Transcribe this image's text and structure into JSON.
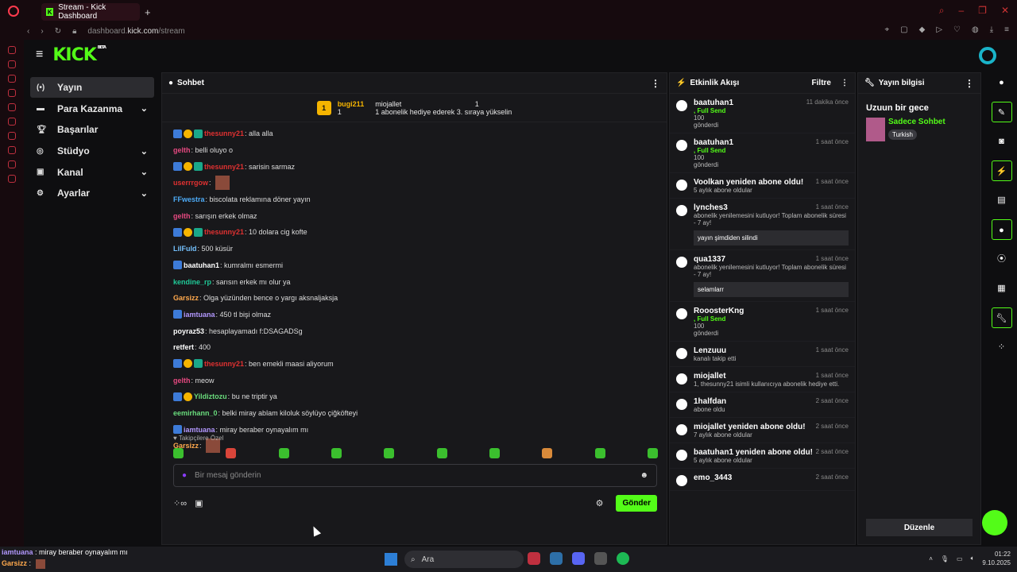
{
  "browser": {
    "tab_title": "Stream - Kick Dashboard",
    "url_prefix": "dashboard.",
    "url_host": "kick.com",
    "url_path": "/stream"
  },
  "app": {
    "logo": "KICK",
    "beta": "BETA",
    "nav": [
      {
        "label": "Yayın",
        "icon": "broadcast-icon",
        "active": true
      },
      {
        "label": "Para Kazanma",
        "icon": "money-icon"
      },
      {
        "label": "Başarılar",
        "icon": "trophy-icon"
      },
      {
        "label": "Stüdyo",
        "icon": "studio-icon"
      },
      {
        "label": "Kanal",
        "icon": "channel-icon"
      },
      {
        "label": "Ayarlar",
        "icon": "settings-icon"
      }
    ]
  },
  "chat": {
    "title": "Sohbet",
    "pinned": {
      "gifter": "bugi211",
      "gifter_count": "1",
      "recipient": "miojallet",
      "recipient_count": "1",
      "message": "1 abonelik hediye ederek 3. sıraya yükselin",
      "rank": "1"
    },
    "messages": [
      {
        "user": "thesunny21",
        "text": "alla alla",
        "color": "#e03131",
        "badges": 3
      },
      {
        "user": "gelth",
        "text": "belli oluyo o",
        "color": "#e64980",
        "badges": 0
      },
      {
        "user": "thesunny21",
        "text": "sarisin sarmaz",
        "color": "#e03131",
        "badges": 3
      },
      {
        "user": "userrrgow",
        "text": "",
        "color": "#e03131",
        "badges": 0,
        "emote": true
      },
      {
        "user": "FFwestra",
        "text": "biscolata reklamına döner yayın",
        "color": "#4dabf7",
        "badges": 0
      },
      {
        "user": "gelth",
        "text": "sarışın erkek olmaz",
        "color": "#e64980",
        "badges": 0
      },
      {
        "user": "thesunny21",
        "text": "10 dolara cig kofte",
        "color": "#e03131",
        "badges": 3
      },
      {
        "user": "LilFuld",
        "text": "500 küsür",
        "color": "#74c0fc",
        "badges": 0
      },
      {
        "user": "baatuhan1",
        "text": "kumralmı esmermi",
        "color": "#ffffff",
        "badges": 1
      },
      {
        "user": "kendine_rp",
        "text": "sarısın erkek mı olur ya",
        "color": "#20c997",
        "badges": 0
      },
      {
        "user": "Garsizz",
        "text": "Olga yüzünden bence o yargı aksnaljaksja",
        "color": "#ffa94d",
        "badges": 0
      },
      {
        "user": "iamtuana",
        "text": "450 tl bişi olmaz",
        "color": "#b197fc",
        "badges": 1
      },
      {
        "user": "poyraz53",
        "text": "hesaplayamadı f:DSAGADSg",
        "color": "#ffffff",
        "badges": 0
      },
      {
        "user": "retfert",
        "text": "400",
        "color": "#ffffff",
        "badges": 0
      },
      {
        "user": "thesunny21",
        "text": "ben emekli maasi aliyorum",
        "color": "#e03131",
        "badges": 3
      },
      {
        "user": "gelth",
        "text": "meow",
        "color": "#e64980",
        "badges": 0
      },
      {
        "user": "Yildiztozu",
        "text": "bu ne triptir ya",
        "color": "#69db7c",
        "badges": 2
      },
      {
        "user": "eemirhann_0",
        "text": "belki miray ablam kiloluk söylüyo çiğköfteyi",
        "color": "#69db7c",
        "badges": 0
      },
      {
        "user": "iamtuana",
        "text": "miray beraber oynayalım mı",
        "color": "#b197fc",
        "badges": 1
      },
      {
        "user": "Garsizz",
        "text": "",
        "color": "#ffa94d",
        "badges": 0,
        "emote": true
      }
    ],
    "follow_only": "Takipçilere Özel",
    "input_placeholder": "Bir mesaj gönderin",
    "send_label": "Gönder"
  },
  "activity": {
    "title": "Etkinlik Akışı",
    "filter": "Filtre",
    "items": [
      {
        "name": "baatuhan1",
        "time": "11 dakika önce",
        "line1": ", Full Send",
        "line2": "100",
        "line3": "gönderdi"
      },
      {
        "name": "baatuhan1",
        "time": "1 saat önce",
        "line1": ", Full Send",
        "line2": "100",
        "line3": "gönderdi"
      },
      {
        "name": "Voolkan yeniden abone oldu!",
        "time": "1 saat önce",
        "line1": "5 aylık abone oldular",
        "line2": "",
        "line3": ""
      },
      {
        "name": "lynches3",
        "time": "1 saat önce",
        "line1": "abonelik yenilemesini kutluyor! Toplam abonelik süresi - 7 ay!",
        "line2": "",
        "line3": "",
        "note": "yayın şimdiden silindi"
      },
      {
        "name": "qua1337",
        "time": "1 saat önce",
        "line1": "abonelik yenilemesini kutluyor! Toplam abonelik süresi - 7 ay!",
        "line2": "",
        "line3": "",
        "note": "selamlarr"
      },
      {
        "name": "RooosterKng",
        "time": "1 saat önce",
        "line1": ", Full Send",
        "line2": "100",
        "line3": "gönderdi"
      },
      {
        "name": "Lenzuuu",
        "time": "1 saat önce",
        "line1": "kanalı takip etti",
        "line2": "",
        "line3": ""
      },
      {
        "name": "miojallet",
        "time": "1 saat önce",
        "line1": "1, thesunny21 isimli kullanıcıya abonelik hediye etti.",
        "line2": "",
        "line3": ""
      },
      {
        "name": "1halfdan",
        "time": "2 saat önce",
        "line1": "abone oldu",
        "line2": "",
        "line3": ""
      },
      {
        "name": "miojallet yeniden abone oldu!",
        "time": "2 saat önce",
        "line1": "7 aylık abone oldular",
        "line2": "",
        "line3": ""
      },
      {
        "name": "baatuhan1 yeniden abone oldu!",
        "time": "2 saat önce",
        "line1": "5 aylık abone oldular",
        "line2": "",
        "line3": ""
      },
      {
        "name": "emo_3443",
        "time": "2 saat önce",
        "line1": "",
        "line2": "",
        "line3": ""
      }
    ]
  },
  "stream_info": {
    "title": "Yayın bilgisi",
    "stream_title": "Uzuun bir gece",
    "category": "Sadece Sohbet",
    "tag": "Turkish",
    "edit_label": "Düzenle"
  },
  "taskbar": {
    "search": "Ara",
    "time": "01:22",
    "date": "9.10.2025"
  },
  "overlay": [
    {
      "user": "iamtuana",
      "text": "miray beraber oynayalım mı"
    },
    {
      "user": "Garsizz",
      "text": ""
    }
  ]
}
